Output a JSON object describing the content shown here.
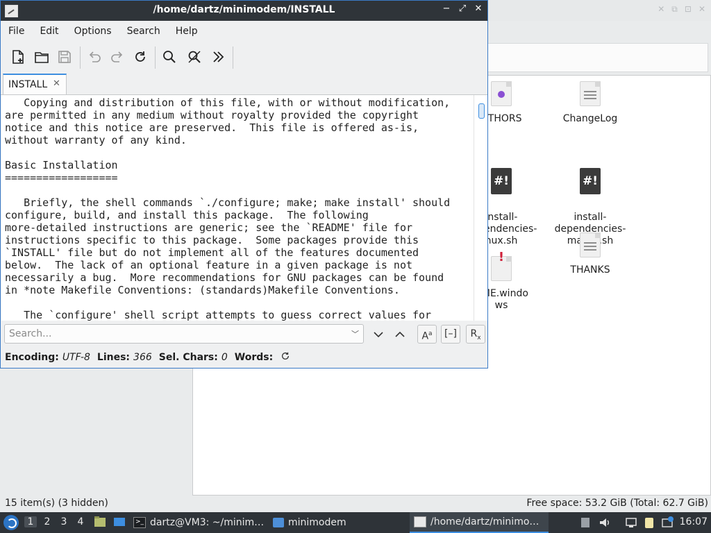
{
  "file_manager": {
    "files": [
      {
        "name": "UTHORS",
        "icon": "person-doc-icon"
      },
      {
        "name": "ChangeLog",
        "icon": "text-doc-icon"
      },
      {
        "name": "install-\ndependencies-\nnux.sh",
        "icon": "script-icon"
      },
      {
        "name": "install-\ndependencies-\nmacos.sh",
        "icon": "script-icon"
      },
      {
        "name": "DME.windo\nws",
        "icon": "warning-doc-icon"
      },
      {
        "name": "THANKS",
        "icon": "text-doc-icon"
      }
    ],
    "status_left": "15 item(s) (3 hidden)",
    "status_right": "Free space: 53.2 GiB (Total: 62.7 GiB)"
  },
  "editor": {
    "title": "/home/dartz/minimodem/INSTALL",
    "menu": [
      "File",
      "Edit",
      "Options",
      "Search",
      "Help"
    ],
    "tab_label": "INSTALL",
    "text": "   Copying and distribution of this file, with or without modification,\nare permitted in any medium without royalty provided the copyright\nnotice and this notice are preserved.  This file is offered as-is,\nwithout warranty of any kind.\n\nBasic Installation\n==================\n\n   Briefly, the shell commands `./configure; make; make install' should\nconfigure, build, and install this package.  The following\nmore-detailed instructions are generic; see the `README' file for\ninstructions specific to this package.  Some packages provide this\n`INSTALL' file but do not implement all of the features documented\nbelow.  The lack of an optional feature in a given package is not\nnecessarily a bug.  More recommendations for GNU packages can be found\nin *note Makefile Conventions: (standards)Makefile Conventions.\n\n   The `configure' shell script attempts to guess correct values for",
    "search": {
      "placeholder": "Search..."
    },
    "status": {
      "encoding_label": "Encoding:",
      "encoding_value": "UTF-8",
      "lines_label": "Lines:",
      "lines_value": "366",
      "selchars_label": "Sel. Chars:",
      "selchars_value": "0",
      "words_label": "Words:"
    }
  },
  "taskbar": {
    "workspaces": [
      "1",
      "2",
      "3",
      "4"
    ],
    "tasks": [
      {
        "label": "dartz@VM3: ~/minim…"
      },
      {
        "label": "minimodem"
      },
      {
        "label": "/home/dartz/minimo…"
      }
    ],
    "clock": "16:07"
  },
  "colors": {
    "accent": "#3d8ee0",
    "titlebar": "#2f3439",
    "taskbar": "#2e3338"
  }
}
